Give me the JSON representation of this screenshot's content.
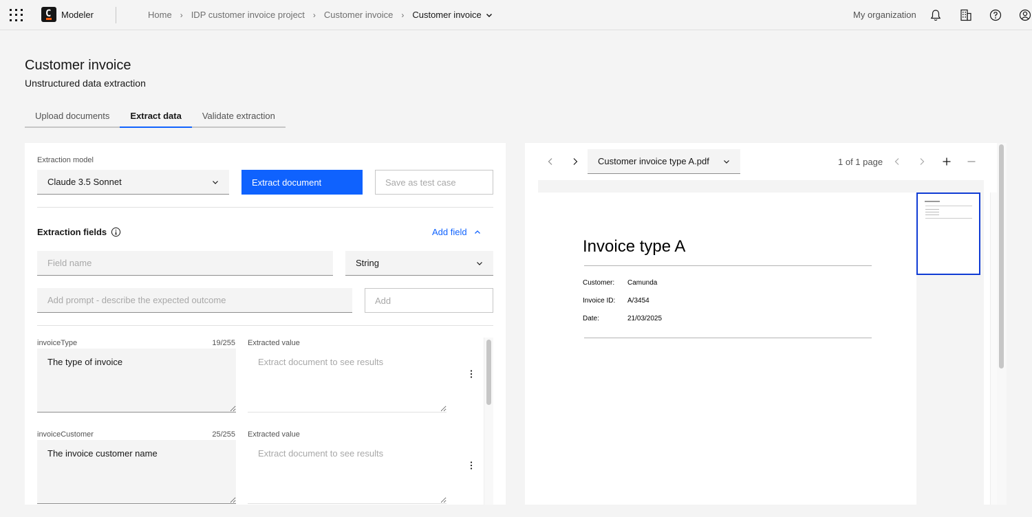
{
  "header": {
    "app_name": "Modeler",
    "breadcrumbs": [
      "Home",
      "IDP customer invoice project",
      "Customer invoice",
      "Customer invoice"
    ],
    "organization": "My organization",
    "icons": [
      "app-switcher-icon",
      "notification-icon",
      "building-icon",
      "help-icon",
      "user-icon"
    ]
  },
  "page": {
    "title": "Customer invoice",
    "subtitle": "Unstructured data extraction"
  },
  "tabs": [
    {
      "label": "Upload documents",
      "active": false
    },
    {
      "label": "Extract data",
      "active": true
    },
    {
      "label": "Validate extraction",
      "active": false
    }
  ],
  "extraction": {
    "model_label": "Extraction model",
    "model_value": "Claude 3.5 Sonnet",
    "extract_button": "Extract document",
    "save_test_case_button": "Save as test case",
    "fields_title": "Extraction fields",
    "add_field_link": "Add field",
    "field_name_placeholder": "Field name",
    "type_value": "String",
    "prompt_placeholder": "Add prompt - describe the expected outcome",
    "add_button": "Add",
    "fields": [
      {
        "name": "invoiceType",
        "count": "19/255",
        "extracted_label": "Extracted value",
        "prompt": "The type of invoice",
        "value_placeholder": "Extract document to see results"
      },
      {
        "name": "invoiceCustomer",
        "count": "25/255",
        "extracted_label": "Extracted value",
        "prompt": "The invoice customer name",
        "value_placeholder": "Extract document to see results"
      }
    ]
  },
  "viewer": {
    "document_name": "Customer invoice type A.pdf",
    "page_count": "1 of 1 page",
    "document": {
      "title": "Invoice type A",
      "rows": [
        {
          "label": "Customer:",
          "value": "Camunda"
        },
        {
          "label": "Invoice ID:",
          "value": "A/3454"
        },
        {
          "label": "Date:",
          "value": "21/03/2025"
        }
      ]
    }
  },
  "colors": {
    "primary": "#0f62fe",
    "thumbnail_border": "#0f3bd4",
    "logo_accent": "#fc5d0d"
  }
}
